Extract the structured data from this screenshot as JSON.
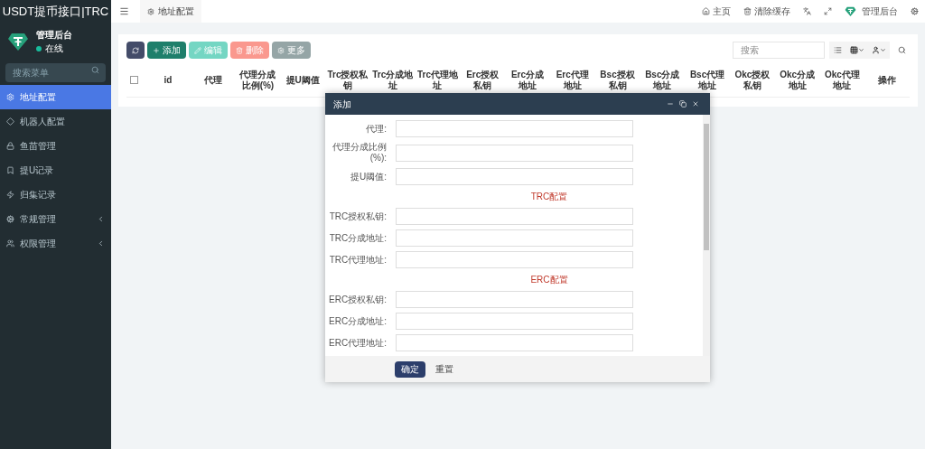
{
  "sidebar": {
    "title": "USDT提币接口|TRC",
    "user": {
      "name": "管理后台",
      "status": "在线"
    },
    "search": {
      "placeholder": "搜索菜单"
    },
    "items": [
      {
        "label": "地址配置",
        "selected": true,
        "expandable": false
      },
      {
        "label": "机器人配置",
        "selected": false,
        "expandable": false
      },
      {
        "label": "鱼苗管理",
        "selected": false,
        "expandable": false
      },
      {
        "label": "提U记录",
        "selected": false,
        "expandable": false
      },
      {
        "label": "归集记录",
        "selected": false,
        "expandable": false
      },
      {
        "label": "常规管理",
        "selected": false,
        "expandable": true
      },
      {
        "label": "权限管理",
        "selected": false,
        "expandable": true
      }
    ]
  },
  "topbar": {
    "tab": "地址配置",
    "links": [
      {
        "kind": "home",
        "label": "主页"
      },
      {
        "kind": "trash",
        "label": "清除缓存"
      },
      {
        "kind": "translate"
      },
      {
        "kind": "fullscreen"
      },
      {
        "kind": "user",
        "label": "管理后台"
      },
      {
        "kind": "settings"
      }
    ]
  },
  "toolbar": {
    "buttons": [
      {
        "kind": "refresh",
        "disabled": false
      },
      {
        "kind": "add",
        "label": "添加",
        "disabled": false
      },
      {
        "kind": "edit",
        "label": "编辑",
        "disabled": true
      },
      {
        "kind": "delete",
        "label": "删除",
        "disabled": true
      },
      {
        "kind": "more",
        "label": "更多",
        "disabled": false
      }
    ],
    "search": {
      "placeholder": "搜索"
    }
  },
  "table": {
    "select_all": {
      "checked": false
    },
    "columns": [
      "id",
      "代理",
      "代理分成比例(%)",
      "提U阈值",
      "Trc授权私钥",
      "Trc分成地址",
      "Trc代理地址",
      "Erc授权私钥",
      "Erc分成地址",
      "Erc代理地址",
      "Bsc授权私钥",
      "Bsc分成地址",
      "Bsc代理地址",
      "Okc授权私钥",
      "Okc分成地址",
      "Okc代理地址",
      "操作"
    ]
  },
  "dialog": {
    "title": "添加",
    "rows": [
      {
        "kind": "field",
        "label": "代理:"
      },
      {
        "kind": "field",
        "label": "代理分成比例(%):"
      },
      {
        "kind": "field",
        "label": "提U阈值:"
      },
      {
        "kind": "heading",
        "label": "TRC配置"
      },
      {
        "kind": "field",
        "label": "TRC授权私钥:"
      },
      {
        "kind": "field",
        "label": "TRC分成地址:"
      },
      {
        "kind": "field",
        "label": "TRC代理地址:"
      },
      {
        "kind": "heading",
        "label": "ERC配置"
      },
      {
        "kind": "field",
        "label": "ERC授权私钥:"
      },
      {
        "kind": "field",
        "label": "ERC分成地址:"
      },
      {
        "kind": "field",
        "label": "ERC代理地址:"
      }
    ],
    "buttons": [
      {
        "kind": "primary",
        "label": "确定"
      },
      {
        "kind": "default",
        "label": "重置"
      }
    ]
  }
}
